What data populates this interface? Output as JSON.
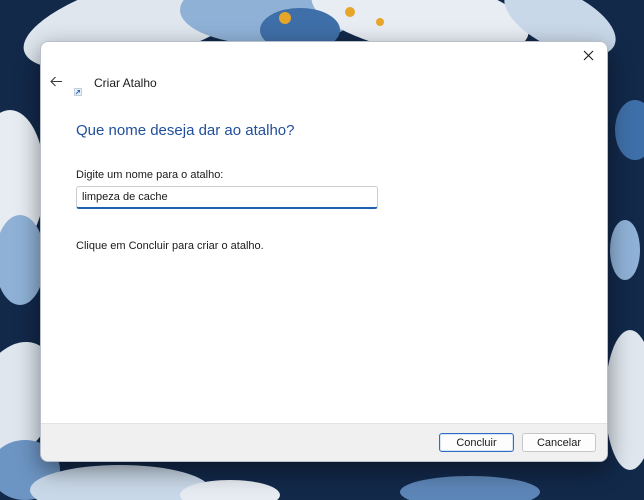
{
  "window": {
    "title": "Criar Atalho"
  },
  "main": {
    "heading": "Que nome deseja dar ao atalho?",
    "field_label": "Digite um nome para o atalho:",
    "name_value": "limpeza de cache",
    "hint": "Clique em Concluir para criar o atalho."
  },
  "footer": {
    "finish_label": "Concluir",
    "cancel_label": "Cancelar"
  },
  "icons": {
    "back": "arrow-left-icon",
    "close": "close-icon",
    "wizard": "shortcut-wizard-icon"
  },
  "colors": {
    "heading": "#1f4e9c",
    "accent": "#1f5fae",
    "wallpaper": "#12294a"
  }
}
